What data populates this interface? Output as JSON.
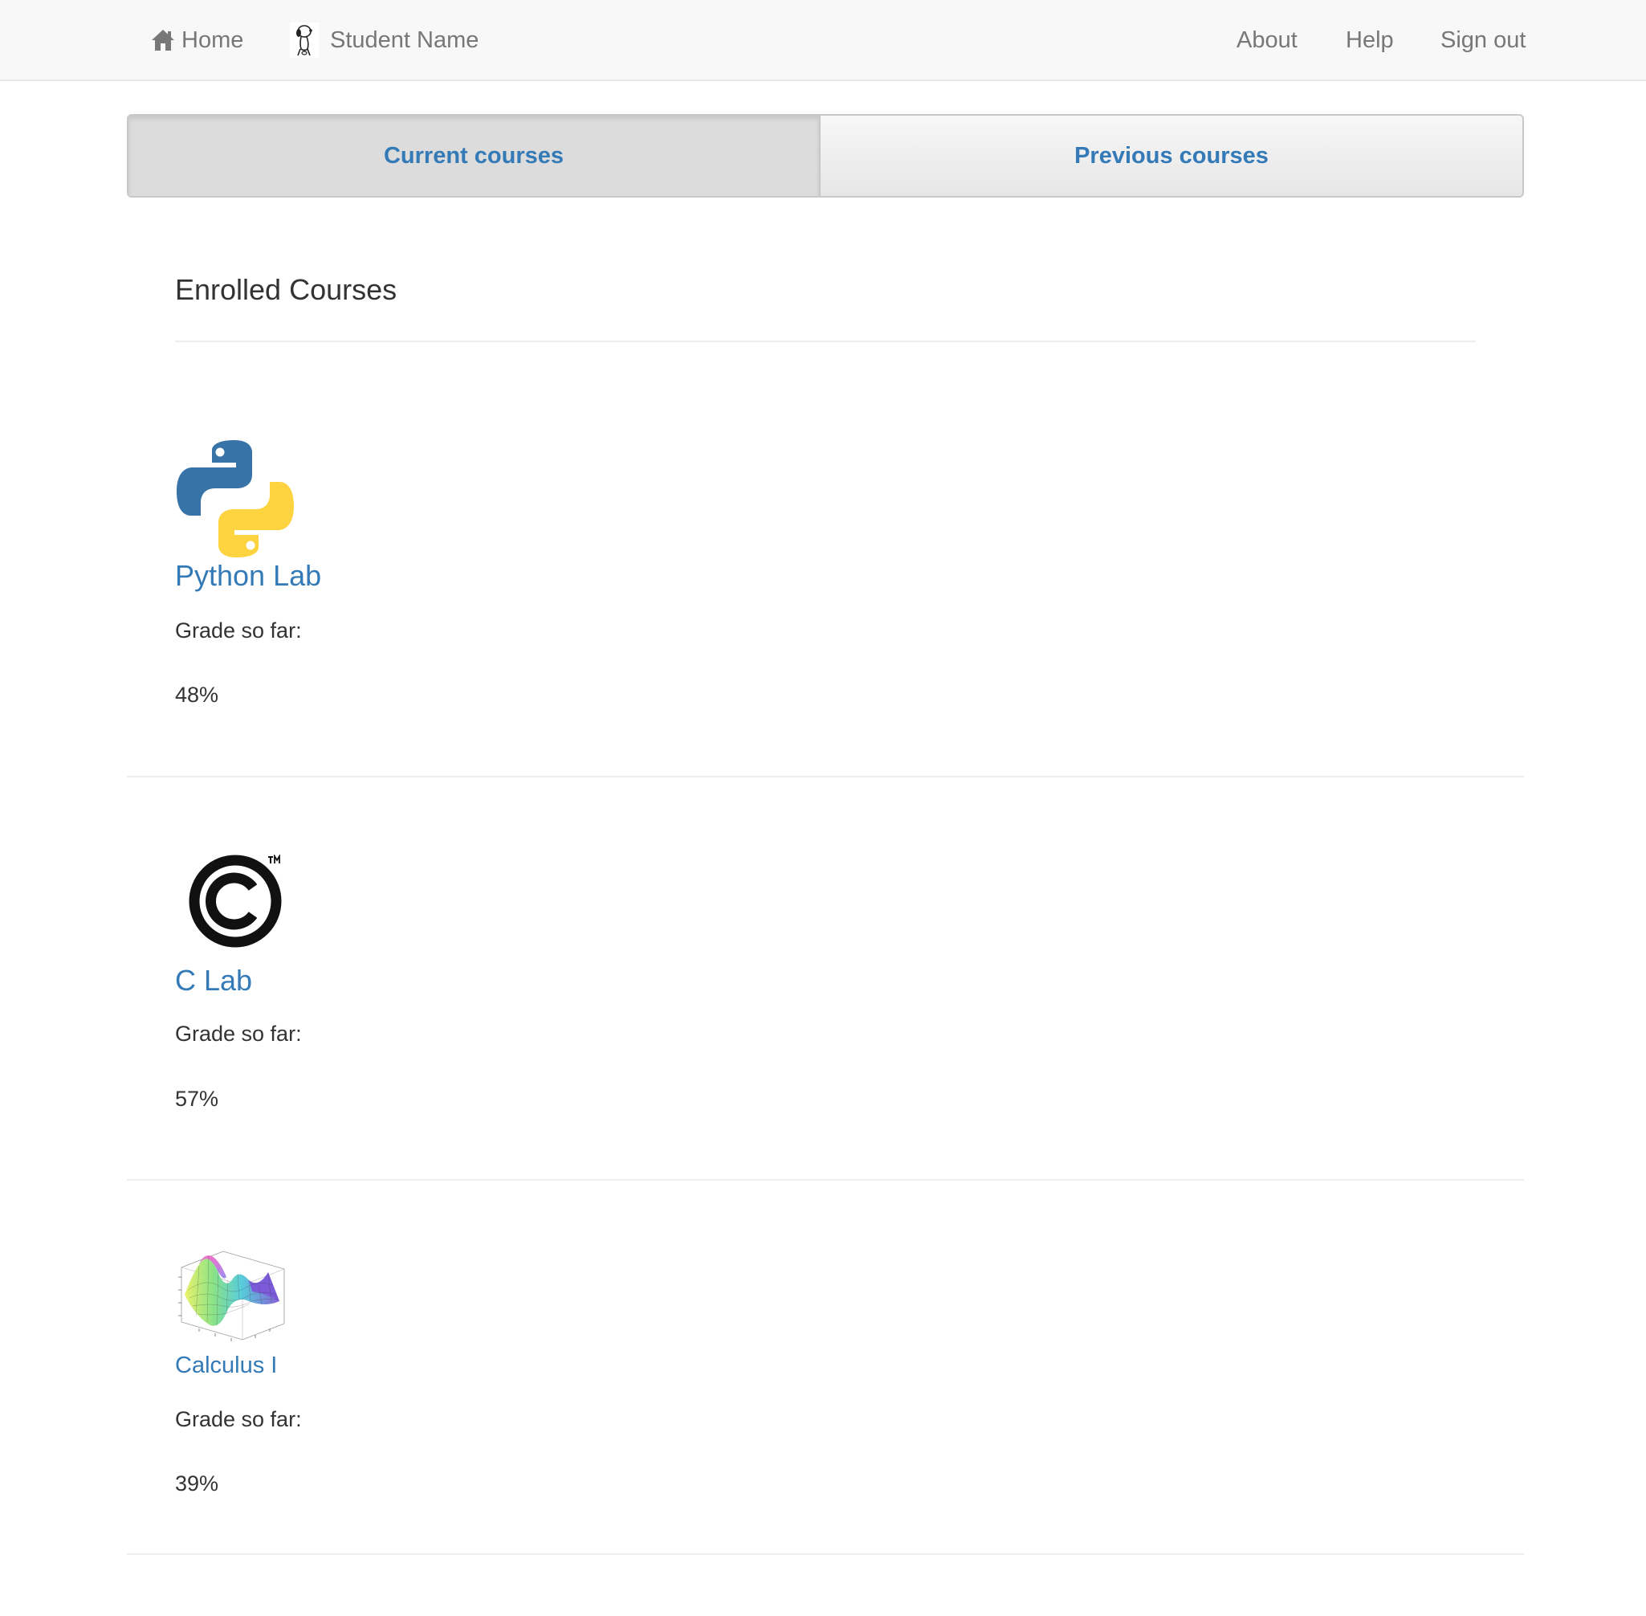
{
  "navbar": {
    "home_label": "Home",
    "home_icon": "home-icon",
    "user_name": "Student Name",
    "user_avatar": "avatar-snoopy",
    "about_label": "About",
    "help_label": "Help",
    "signout_label": "Sign out"
  },
  "tabs": {
    "current_label": "Current courses",
    "previous_label": "Previous courses",
    "active": "current"
  },
  "main": {
    "heading": "Enrolled Courses",
    "grade_label": "Grade so far:"
  },
  "courses": [
    {
      "name": "Python Lab",
      "grade": "48%",
      "icon": "python-logo-icon"
    },
    {
      "name": "C Lab",
      "grade": "57%",
      "icon": "c-logo-icon"
    },
    {
      "name": "Calculus I",
      "grade": "39%",
      "icon": "3d-surface-plot-icon"
    }
  ],
  "colors": {
    "link": "#337ab7",
    "navbar_bg": "#f8f8f8",
    "nav_text": "#777777",
    "text": "#333333"
  }
}
